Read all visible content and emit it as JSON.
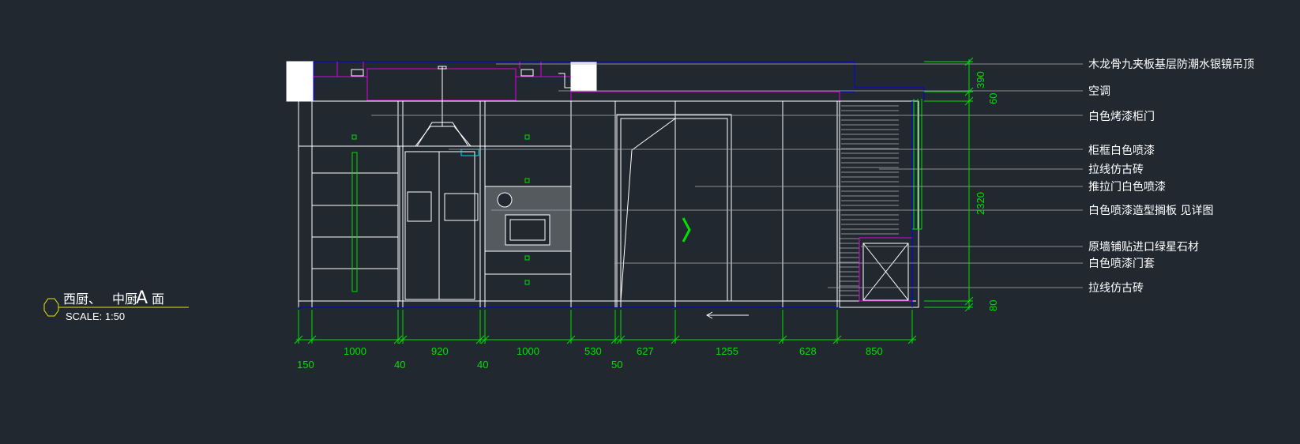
{
  "title": {
    "part1": "西厨、",
    "part2": "中厨",
    "big": "A",
    "part3": "面"
  },
  "scale": "SCALE: 1:50",
  "annotations": [
    "木龙骨九夹板基层防潮水银镜吊顶",
    "空调",
    "白色烤漆柜门",
    "柜框白色喷漆",
    "拉线仿古砖",
    "推拉门白色喷漆",
    "白色喷漆造型搁板 见详图",
    "原墙铺贴进口绿星石材",
    "白色喷漆门套",
    "拉线仿古砖"
  ],
  "dims_horizontal_top": [
    "1000",
    "920",
    "1000",
    "530",
    "627",
    "1255",
    "628",
    "850"
  ],
  "dims_horizontal_bottom": [
    "150",
    "40",
    "40",
    "50"
  ],
  "dims_vertical": [
    "390",
    "60",
    "2320",
    "80"
  ],
  "colors": {
    "background": "#212830",
    "line": "#ffffff",
    "dimension": "#00e000",
    "accent_magenta": "#e000e0",
    "accent_blue": "#0000ee",
    "accent_yellow": "#e8e800"
  }
}
